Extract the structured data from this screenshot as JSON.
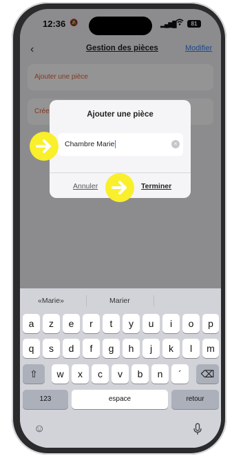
{
  "status_bar": {
    "time": "12:36",
    "battery": "81"
  },
  "nav": {
    "back_symbol": "‹",
    "title": "Gestion des pièces",
    "edit_label": "Modifier"
  },
  "rows": {
    "add_room": "Ajouter une pièce",
    "create_prefix": "Créer"
  },
  "dialog": {
    "title": "Ajouter une pièce",
    "input_value": "Chambre Marie",
    "clear_symbol": "×",
    "cancel_label": "Annuler",
    "finish_label": "Terminer"
  },
  "keyboard": {
    "suggestions": [
      "«Marie»",
      "Marier"
    ],
    "row1": [
      "a",
      "z",
      "e",
      "r",
      "t",
      "y",
      "u",
      "i",
      "o",
      "p"
    ],
    "row2": [
      "q",
      "s",
      "d",
      "f",
      "g",
      "h",
      "j",
      "k",
      "l",
      "m"
    ],
    "row3": [
      "w",
      "x",
      "c",
      "v",
      "b",
      "n",
      "´"
    ],
    "shift_symbol": "⇧",
    "delete_symbol": "⌫",
    "numbers_label": "123",
    "space_label": "espace",
    "return_label": "retour",
    "emoji_symbol": "☺",
    "mic_symbol": "🎙"
  },
  "colors": {
    "accent_orange": "#e0623a",
    "link_blue": "#2f7cf6",
    "highlight_yellow": "#f9ef2b"
  }
}
